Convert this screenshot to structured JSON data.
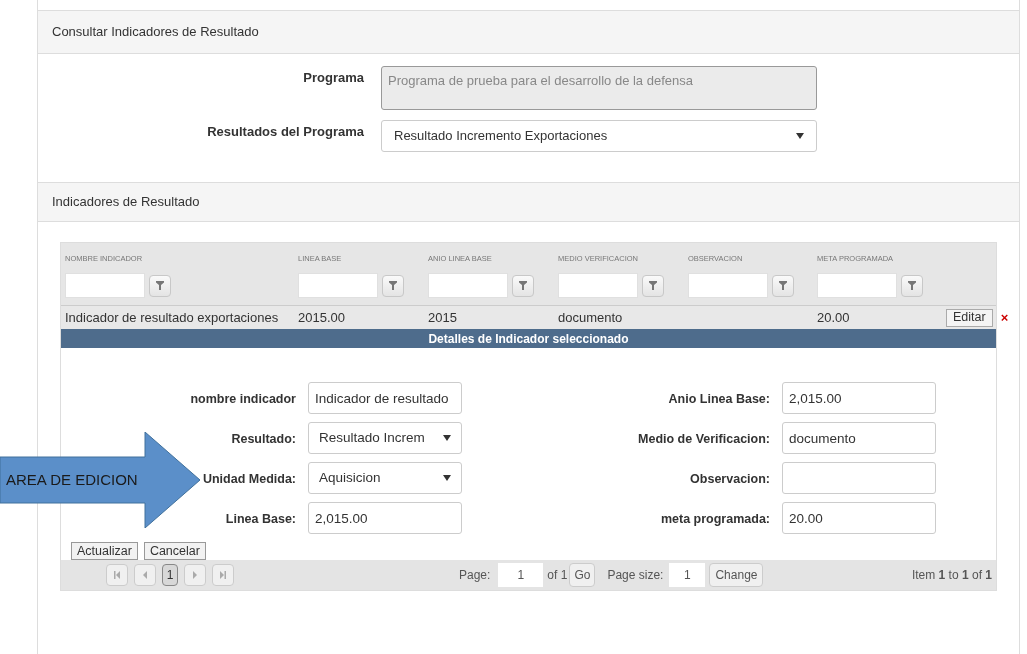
{
  "panel_title": "Consultar Indicadores de Resultado",
  "program_fields": [
    {
      "label": "Programa",
      "value": "Programa de prueba para el desarrollo de la defensa",
      "kind": "textarea"
    },
    {
      "label": "Resultados del Programa",
      "value": "Resultado Incremento Exportaciones",
      "kind": "select"
    }
  ],
  "section_title": "Indicadores de Resultado",
  "table": {
    "columns": [
      "NOMBRE INDICADOR",
      "LINEA BASE",
      "ANIO LINEA BASE",
      "MEDIO VERIFICACION",
      "OBSERVACION",
      "META PROGRAMADA"
    ],
    "rows": [
      {
        "cells": [
          "Indicador de resultado exportaciones",
          "2015.00",
          "2015",
          "documento",
          null,
          "20.00"
        ],
        "selected": true,
        "edit_button": "Editar",
        "delete_icon": "×"
      }
    ]
  },
  "details": {
    "title": "Detalles de Indicador seleccionado",
    "left_fields": [
      {
        "label": "nombre indicador",
        "value": "Indicador de resultado",
        "kind": "text"
      },
      {
        "label": "Resultado:",
        "value": "Resultado Increm",
        "kind": "select"
      },
      {
        "label": "Unidad Medida:",
        "value": "Aquisicion",
        "kind": "select"
      },
      {
        "label": "Linea Base:",
        "value": "2,015.00",
        "kind": "text"
      }
    ],
    "right_fields": [
      {
        "label": "Anio Linea Base:",
        "value": "2,015.00",
        "kind": "text"
      },
      {
        "label": "Medio de Verificacion:",
        "value": "documento",
        "kind": "text"
      },
      {
        "label": "Observacion:",
        "kind": "text"
      },
      {
        "label": "meta programada:",
        "value": "20.00",
        "kind": "text"
      }
    ],
    "buttons": [
      "Actualizar",
      "Cancelar"
    ]
  },
  "pager": {
    "pages": [
      {
        "label": "1",
        "selected": true
      }
    ],
    "page_label": "Page:",
    "page_value": "1",
    "of_text": "of 1",
    "go": "Go",
    "size_label": "Page size:",
    "size_value": "1",
    "change": "Change",
    "summary": "Item **1** to **1** of **1**"
  },
  "callout": {
    "text": "AREA DE EDICION"
  }
}
